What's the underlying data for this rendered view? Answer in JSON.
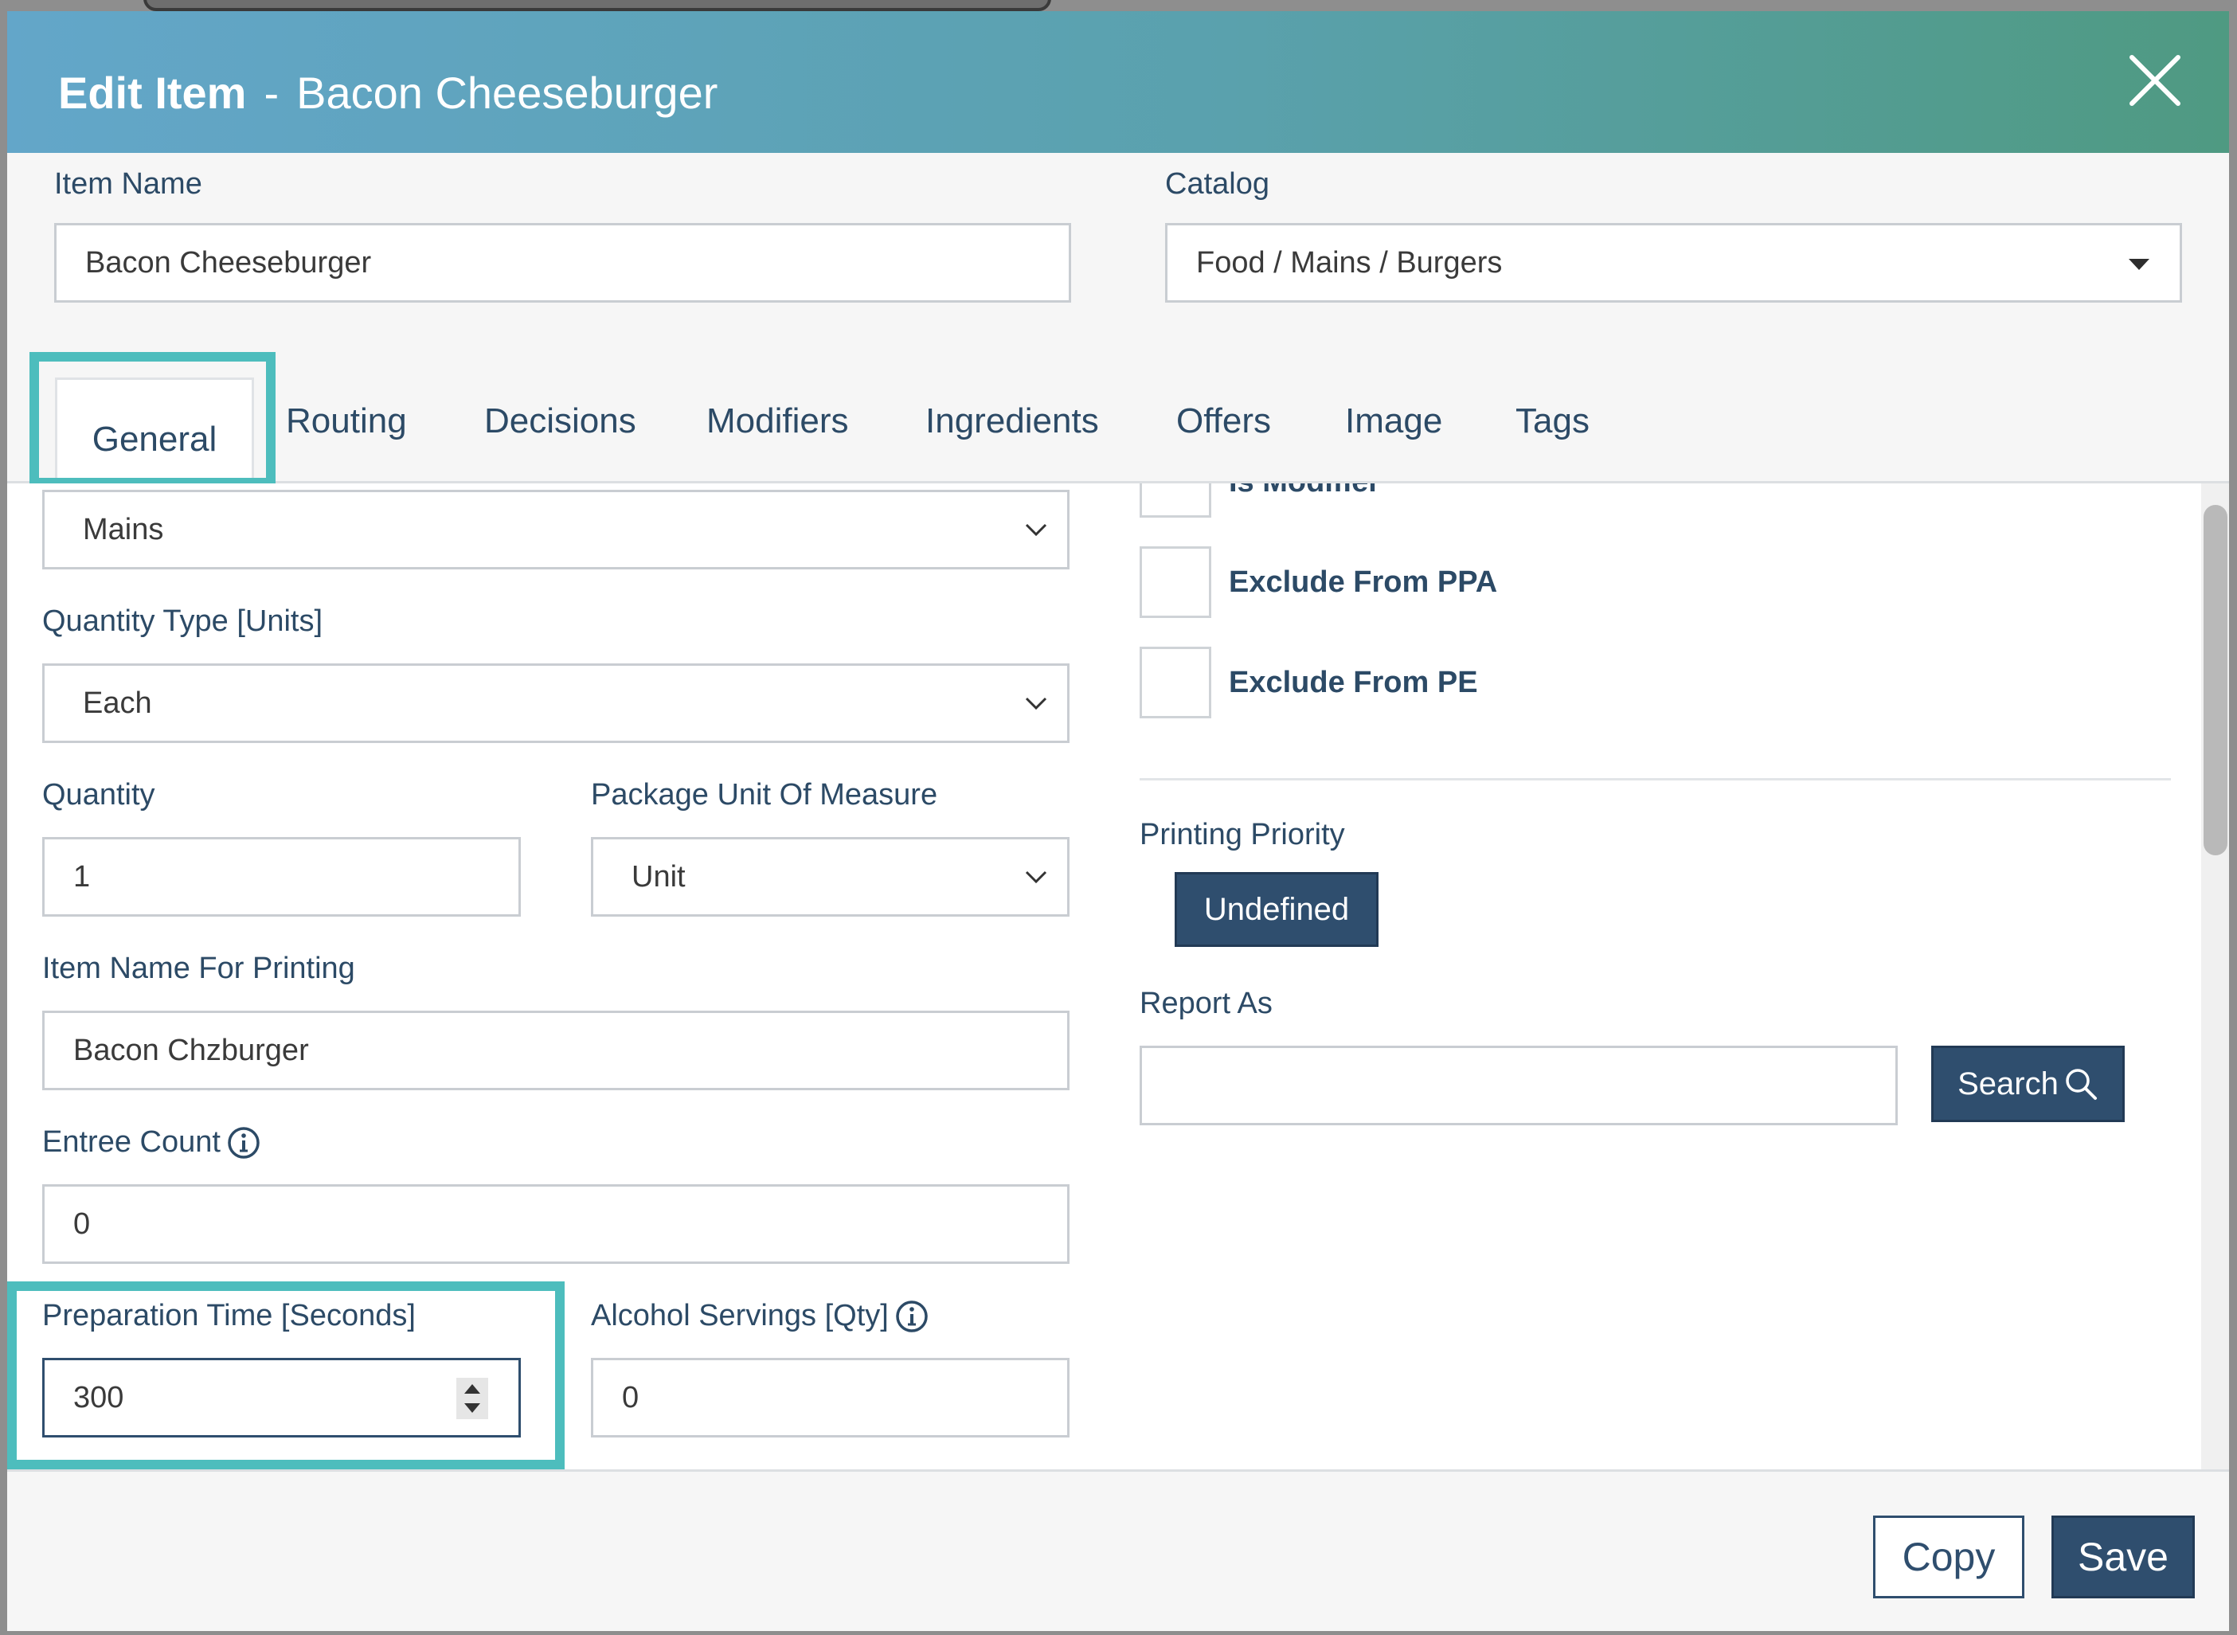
{
  "modal": {
    "title": "Edit Item",
    "separator": "-",
    "item_title": "Bacon Cheeseburger"
  },
  "item_name": {
    "label": "Item Name",
    "value": "Bacon Cheeseburger"
  },
  "catalog": {
    "label": "Catalog",
    "value": "Food / Mains / Burgers"
  },
  "tabs": [
    {
      "label": "General",
      "active": true
    },
    {
      "label": "Routing"
    },
    {
      "label": "Decisions"
    },
    {
      "label": "Modifiers"
    },
    {
      "label": "Ingredients"
    },
    {
      "label": "Offers"
    },
    {
      "label": "Image"
    },
    {
      "label": "Tags"
    }
  ],
  "general": {
    "category_select": {
      "value": "Mains"
    },
    "quantity_type": {
      "label": "Quantity Type [Units]",
      "value": "Each"
    },
    "quantity": {
      "label": "Quantity",
      "value": "1"
    },
    "package_unit": {
      "label": "Package Unit Of Measure",
      "value": "Unit"
    },
    "item_name_printing": {
      "label": "Item Name For Printing",
      "value": "Bacon Chzburger"
    },
    "entree_count": {
      "label": "Entree Count",
      "value": "0"
    },
    "preparation_time": {
      "label": "Preparation Time [Seconds]",
      "value": "300"
    },
    "alcohol_servings": {
      "label": "Alcohol Servings [Qty]",
      "value": "0"
    },
    "checkboxes": [
      {
        "label": "Is Modifier",
        "checked": false
      },
      {
        "label": "Exclude From PPA",
        "checked": false
      },
      {
        "label": "Exclude From PE",
        "checked": false
      }
    ],
    "printing_priority": {
      "label": "Printing Priority",
      "button": "Undefined"
    },
    "report_as": {
      "label": "Report As",
      "value": "",
      "search_button": "Search"
    }
  },
  "footer": {
    "copy": "Copy",
    "save": "Save"
  },
  "colors": {
    "header_start": "#63a6c9",
    "header_end": "#4f9a82",
    "primary_button": "#2f4e6e",
    "highlight": "#4dbdbd",
    "label_text": "#2c4a66"
  },
  "icons": {
    "close": "close-icon",
    "info": "info-icon",
    "search": "search-icon",
    "dropdown": "chevron-down-icon",
    "spinner": "spinner-arrows-icon"
  }
}
